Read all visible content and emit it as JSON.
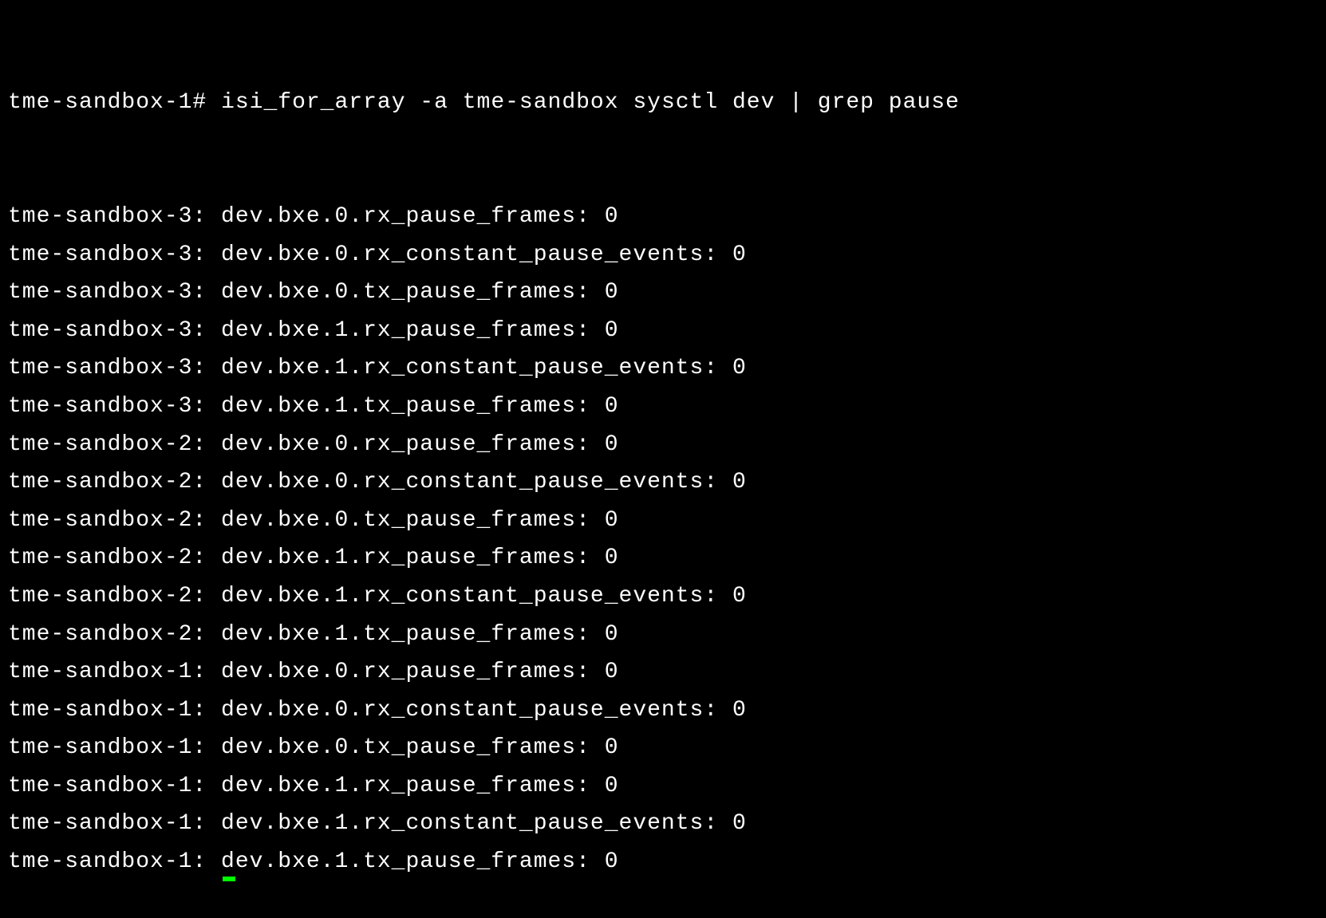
{
  "terminal": {
    "prompt": "tme-sandbox-1#",
    "command": "isi_for_array -a tme-sandbox sysctl dev | grep pause",
    "output": [
      {
        "host": "tme-sandbox-3",
        "key": "dev.bxe.0.rx_pause_frames",
        "value": "0"
      },
      {
        "host": "tme-sandbox-3",
        "key": "dev.bxe.0.rx_constant_pause_events",
        "value": "0"
      },
      {
        "host": "tme-sandbox-3",
        "key": "dev.bxe.0.tx_pause_frames",
        "value": "0"
      },
      {
        "host": "tme-sandbox-3",
        "key": "dev.bxe.1.rx_pause_frames",
        "value": "0"
      },
      {
        "host": "tme-sandbox-3",
        "key": "dev.bxe.1.rx_constant_pause_events",
        "value": "0"
      },
      {
        "host": "tme-sandbox-3",
        "key": "dev.bxe.1.tx_pause_frames",
        "value": "0"
      },
      {
        "host": "tme-sandbox-2",
        "key": "dev.bxe.0.rx_pause_frames",
        "value": "0"
      },
      {
        "host": "tme-sandbox-2",
        "key": "dev.bxe.0.rx_constant_pause_events",
        "value": "0"
      },
      {
        "host": "tme-sandbox-2",
        "key": "dev.bxe.0.tx_pause_frames",
        "value": "0"
      },
      {
        "host": "tme-sandbox-2",
        "key": "dev.bxe.1.rx_pause_frames",
        "value": "0"
      },
      {
        "host": "tme-sandbox-2",
        "key": "dev.bxe.1.rx_constant_pause_events",
        "value": "0"
      },
      {
        "host": "tme-sandbox-2",
        "key": "dev.bxe.1.tx_pause_frames",
        "value": "0"
      },
      {
        "host": "tme-sandbox-1",
        "key": "dev.bxe.0.rx_pause_frames",
        "value": "0"
      },
      {
        "host": "tme-sandbox-1",
        "key": "dev.bxe.0.rx_constant_pause_events",
        "value": "0"
      },
      {
        "host": "tme-sandbox-1",
        "key": "dev.bxe.0.tx_pause_frames",
        "value": "0"
      },
      {
        "host": "tme-sandbox-1",
        "key": "dev.bxe.1.rx_pause_frames",
        "value": "0"
      },
      {
        "host": "tme-sandbox-1",
        "key": "dev.bxe.1.rx_constant_pause_events",
        "value": "0"
      },
      {
        "host": "tme-sandbox-1",
        "key": "dev.bxe.1.tx_pause_frames",
        "value": "0"
      }
    ]
  }
}
